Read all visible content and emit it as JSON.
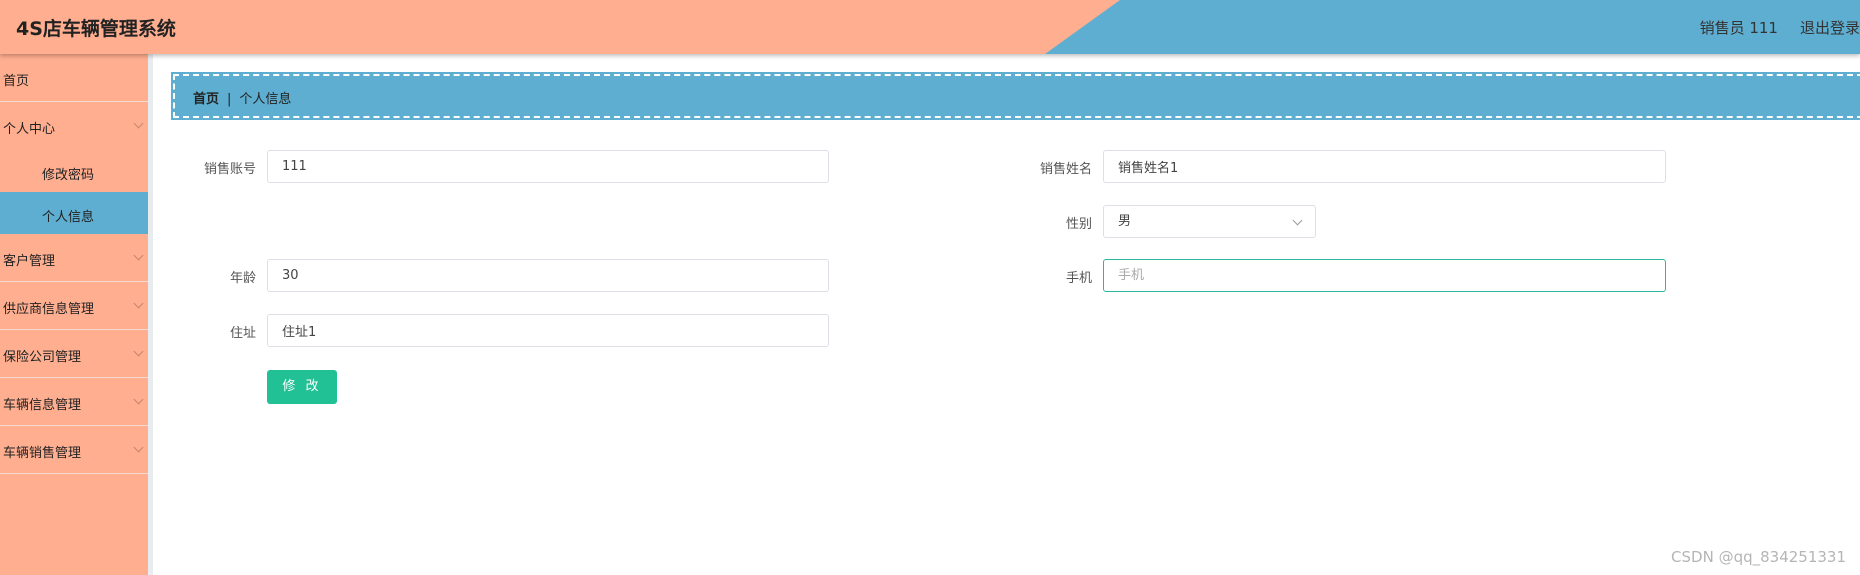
{
  "header": {
    "title": "4S店车辆管理系统",
    "user": "销售员 111",
    "logout": "退出登录"
  },
  "sidebar": {
    "items": [
      {
        "label": "首页"
      },
      {
        "label": "个人中心"
      },
      {
        "label": "修改密码"
      },
      {
        "label": "个人信息"
      },
      {
        "label": "客户管理"
      },
      {
        "label": "供应商信息管理"
      },
      {
        "label": "保险公司管理"
      },
      {
        "label": "车辆信息管理"
      },
      {
        "label": "车辆销售管理"
      }
    ],
    "active": "个人信息"
  },
  "breadcrumb": {
    "home": "首页",
    "separator": "|",
    "current": "个人信息"
  },
  "form": {
    "account_label": "销售账号",
    "account_value": "111",
    "name_label": "销售姓名",
    "name_value": "销售姓名1",
    "gender_label": "性别",
    "gender_value": "男",
    "age_label": "年龄",
    "age_value": "30",
    "phone_label": "手机",
    "phone_placeholder": "手机",
    "address_label": "住址",
    "address_value": "住址1",
    "submit_label": "修 改"
  },
  "watermark": "CSDN @qq_834251331",
  "colors": {
    "peach": "#ffae90",
    "blue": "#5eaed1",
    "button": "#21c195"
  }
}
